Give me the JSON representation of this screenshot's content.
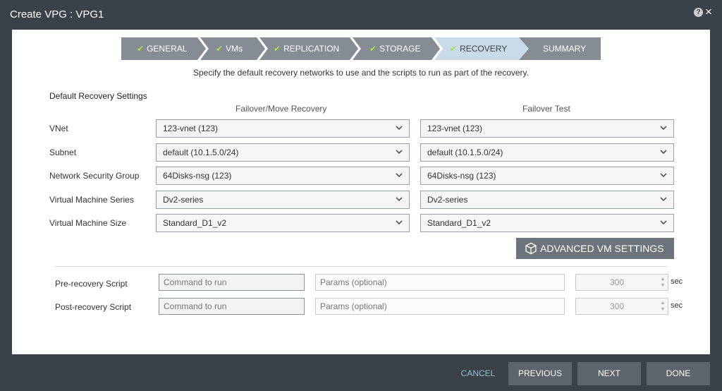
{
  "window": {
    "title": "Create VPG : VPG1",
    "help_icon": "?",
    "close_icon": "×"
  },
  "steps": [
    {
      "label": "GENERAL",
      "done": true
    },
    {
      "label": "VMs",
      "done": true
    },
    {
      "label": "REPLICATION",
      "done": true
    },
    {
      "label": "STORAGE",
      "done": true
    },
    {
      "label": "RECOVERY",
      "done": true,
      "active": true
    },
    {
      "label": "SUMMARY",
      "done": false
    }
  ],
  "check_mark": "✔",
  "instructions": "Specify the default recovery networks to use and the scripts to run as part of the recovery.",
  "section_title": "Default Recovery Settings",
  "columns": {
    "failover": "Failover/Move Recovery",
    "test": "Failover Test"
  },
  "rows": [
    {
      "label": "VNet",
      "failover": "123-vnet (123)",
      "test": "123-vnet (123)"
    },
    {
      "label": "Subnet",
      "failover": "default (10.1.5.0/24)",
      "test": "default (10.1.5.0/24)"
    },
    {
      "label": "Network Security Group",
      "failover": "64Disks-nsg (123)",
      "test": "64Disks-nsg (123)"
    },
    {
      "label": "Virtual Machine Series",
      "failover": "Dv2-series",
      "test": "Dv2-series"
    },
    {
      "label": "Virtual Machine Size",
      "failover": "Standard_D1_v2",
      "test": "Standard_D1_v2"
    }
  ],
  "advanced_button": "ADVANCED VM SETTINGS",
  "scripts": {
    "pre": {
      "label": "Pre-recovery Script",
      "command_placeholder": "Command to run",
      "params_placeholder": "Params (optional)",
      "timeout": "300",
      "unit": "sec"
    },
    "post": {
      "label": "Post-recovery Script",
      "command_placeholder": "Command to run",
      "params_placeholder": "Params (optional)",
      "timeout": "300",
      "unit": "sec"
    }
  },
  "footer": {
    "cancel": "CANCEL",
    "previous": "PREVIOUS",
    "next": "NEXT",
    "done": "DONE"
  },
  "colors": {
    "window_bg": "#3b4149",
    "active_step": "#c9dbe7",
    "inactive_step": "#868c94",
    "check": "#a6e04d",
    "cancel_link": "#8fbfd2",
    "button": "#5d646c"
  }
}
